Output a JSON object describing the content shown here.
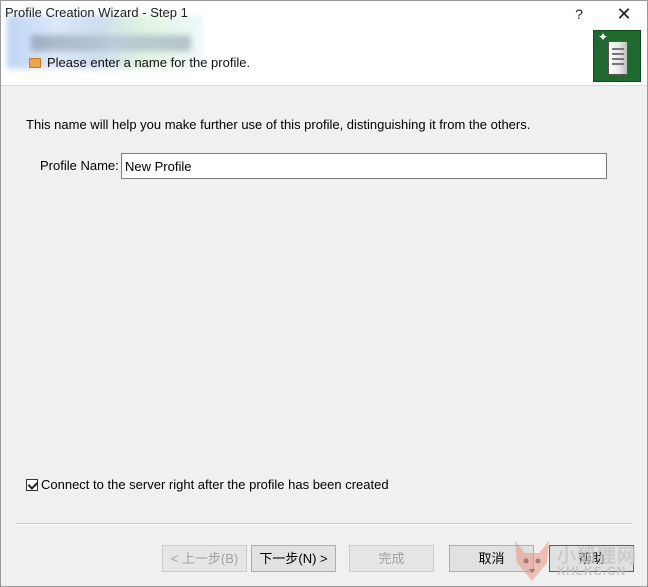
{
  "window": {
    "title": "Profile Creation Wizard - Step 1",
    "help_glyph": "?",
    "close_glyph": "✕"
  },
  "header": {
    "subtitle": "Please enter a name for the profile.",
    "logo_icon": "server-wizard-icon"
  },
  "main": {
    "description": "This name will help you make further use of this profile, distinguishing it from the others.",
    "profile_name_label": "Profile Name:",
    "profile_name_value": "New Profile",
    "connect_checkbox_label": "Connect to the server right after the profile has been created",
    "connect_checkbox_checked": true
  },
  "buttons": {
    "back": "< 上一步(B)",
    "next": "下一步(N) >",
    "finish": "完成",
    "cancel": "取消",
    "help": "帮助"
  },
  "watermark": {
    "line1": "小狐狸网",
    "line2": "XHLKS.CN"
  },
  "colors": {
    "header_bg": "#ffffff",
    "body_bg": "#f0f0f0",
    "logo_bg": "#1f6b2e",
    "focus_border": "#0078d7"
  }
}
